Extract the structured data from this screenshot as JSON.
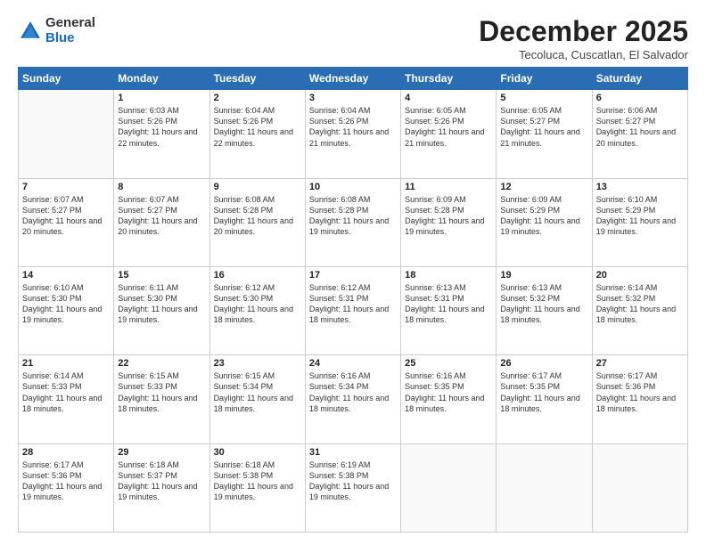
{
  "logo": {
    "general": "General",
    "blue": "Blue"
  },
  "header": {
    "month": "December 2025",
    "location": "Tecoluca, Cuscatlan, El Salvador"
  },
  "weekdays": [
    "Sunday",
    "Monday",
    "Tuesday",
    "Wednesday",
    "Thursday",
    "Friday",
    "Saturday"
  ],
  "weeks": [
    [
      {
        "day": "",
        "sunrise": "",
        "sunset": "",
        "daylight": ""
      },
      {
        "day": "1",
        "sunrise": "Sunrise: 6:03 AM",
        "sunset": "Sunset: 5:26 PM",
        "daylight": "Daylight: 11 hours and 22 minutes."
      },
      {
        "day": "2",
        "sunrise": "Sunrise: 6:04 AM",
        "sunset": "Sunset: 5:26 PM",
        "daylight": "Daylight: 11 hours and 22 minutes."
      },
      {
        "day": "3",
        "sunrise": "Sunrise: 6:04 AM",
        "sunset": "Sunset: 5:26 PM",
        "daylight": "Daylight: 11 hours and 21 minutes."
      },
      {
        "day": "4",
        "sunrise": "Sunrise: 6:05 AM",
        "sunset": "Sunset: 5:26 PM",
        "daylight": "Daylight: 11 hours and 21 minutes."
      },
      {
        "day": "5",
        "sunrise": "Sunrise: 6:05 AM",
        "sunset": "Sunset: 5:27 PM",
        "daylight": "Daylight: 11 hours and 21 minutes."
      },
      {
        "day": "6",
        "sunrise": "Sunrise: 6:06 AM",
        "sunset": "Sunset: 5:27 PM",
        "daylight": "Daylight: 11 hours and 20 minutes."
      }
    ],
    [
      {
        "day": "7",
        "sunrise": "Sunrise: 6:07 AM",
        "sunset": "Sunset: 5:27 PM",
        "daylight": "Daylight: 11 hours and 20 minutes."
      },
      {
        "day": "8",
        "sunrise": "Sunrise: 6:07 AM",
        "sunset": "Sunset: 5:27 PM",
        "daylight": "Daylight: 11 hours and 20 minutes."
      },
      {
        "day": "9",
        "sunrise": "Sunrise: 6:08 AM",
        "sunset": "Sunset: 5:28 PM",
        "daylight": "Daylight: 11 hours and 20 minutes."
      },
      {
        "day": "10",
        "sunrise": "Sunrise: 6:08 AM",
        "sunset": "Sunset: 5:28 PM",
        "daylight": "Daylight: 11 hours and 19 minutes."
      },
      {
        "day": "11",
        "sunrise": "Sunrise: 6:09 AM",
        "sunset": "Sunset: 5:28 PM",
        "daylight": "Daylight: 11 hours and 19 minutes."
      },
      {
        "day": "12",
        "sunrise": "Sunrise: 6:09 AM",
        "sunset": "Sunset: 5:29 PM",
        "daylight": "Daylight: 11 hours and 19 minutes."
      },
      {
        "day": "13",
        "sunrise": "Sunrise: 6:10 AM",
        "sunset": "Sunset: 5:29 PM",
        "daylight": "Daylight: 11 hours and 19 minutes."
      }
    ],
    [
      {
        "day": "14",
        "sunrise": "Sunrise: 6:10 AM",
        "sunset": "Sunset: 5:30 PM",
        "daylight": "Daylight: 11 hours and 19 minutes."
      },
      {
        "day": "15",
        "sunrise": "Sunrise: 6:11 AM",
        "sunset": "Sunset: 5:30 PM",
        "daylight": "Daylight: 11 hours and 19 minutes."
      },
      {
        "day": "16",
        "sunrise": "Sunrise: 6:12 AM",
        "sunset": "Sunset: 5:30 PM",
        "daylight": "Daylight: 11 hours and 18 minutes."
      },
      {
        "day": "17",
        "sunrise": "Sunrise: 6:12 AM",
        "sunset": "Sunset: 5:31 PM",
        "daylight": "Daylight: 11 hours and 18 minutes."
      },
      {
        "day": "18",
        "sunrise": "Sunrise: 6:13 AM",
        "sunset": "Sunset: 5:31 PM",
        "daylight": "Daylight: 11 hours and 18 minutes."
      },
      {
        "day": "19",
        "sunrise": "Sunrise: 6:13 AM",
        "sunset": "Sunset: 5:32 PM",
        "daylight": "Daylight: 11 hours and 18 minutes."
      },
      {
        "day": "20",
        "sunrise": "Sunrise: 6:14 AM",
        "sunset": "Sunset: 5:32 PM",
        "daylight": "Daylight: 11 hours and 18 minutes."
      }
    ],
    [
      {
        "day": "21",
        "sunrise": "Sunrise: 6:14 AM",
        "sunset": "Sunset: 5:33 PM",
        "daylight": "Daylight: 11 hours and 18 minutes."
      },
      {
        "day": "22",
        "sunrise": "Sunrise: 6:15 AM",
        "sunset": "Sunset: 5:33 PM",
        "daylight": "Daylight: 11 hours and 18 minutes."
      },
      {
        "day": "23",
        "sunrise": "Sunrise: 6:15 AM",
        "sunset": "Sunset: 5:34 PM",
        "daylight": "Daylight: 11 hours and 18 minutes."
      },
      {
        "day": "24",
        "sunrise": "Sunrise: 6:16 AM",
        "sunset": "Sunset: 5:34 PM",
        "daylight": "Daylight: 11 hours and 18 minutes."
      },
      {
        "day": "25",
        "sunrise": "Sunrise: 6:16 AM",
        "sunset": "Sunset: 5:35 PM",
        "daylight": "Daylight: 11 hours and 18 minutes."
      },
      {
        "day": "26",
        "sunrise": "Sunrise: 6:17 AM",
        "sunset": "Sunset: 5:35 PM",
        "daylight": "Daylight: 11 hours and 18 minutes."
      },
      {
        "day": "27",
        "sunrise": "Sunrise: 6:17 AM",
        "sunset": "Sunset: 5:36 PM",
        "daylight": "Daylight: 11 hours and 18 minutes."
      }
    ],
    [
      {
        "day": "28",
        "sunrise": "Sunrise: 6:17 AM",
        "sunset": "Sunset: 5:36 PM",
        "daylight": "Daylight: 11 hours and 19 minutes."
      },
      {
        "day": "29",
        "sunrise": "Sunrise: 6:18 AM",
        "sunset": "Sunset: 5:37 PM",
        "daylight": "Daylight: 11 hours and 19 minutes."
      },
      {
        "day": "30",
        "sunrise": "Sunrise: 6:18 AM",
        "sunset": "Sunset: 5:38 PM",
        "daylight": "Daylight: 11 hours and 19 minutes."
      },
      {
        "day": "31",
        "sunrise": "Sunrise: 6:19 AM",
        "sunset": "Sunset: 5:38 PM",
        "daylight": "Daylight: 11 hours and 19 minutes."
      },
      {
        "day": "",
        "sunrise": "",
        "sunset": "",
        "daylight": ""
      },
      {
        "day": "",
        "sunrise": "",
        "sunset": "",
        "daylight": ""
      },
      {
        "day": "",
        "sunrise": "",
        "sunset": "",
        "daylight": ""
      }
    ]
  ]
}
